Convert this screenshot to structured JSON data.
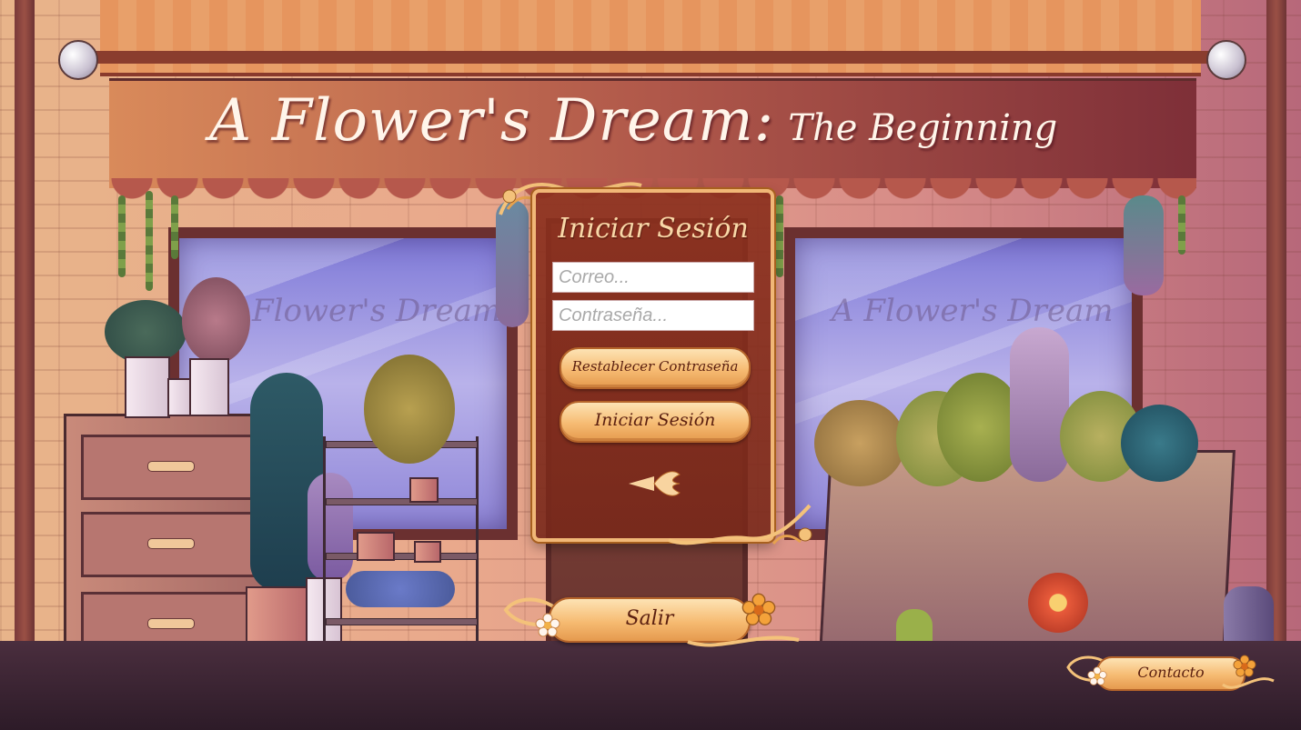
{
  "game": {
    "title_main": "A Flower's Dream:",
    "title_sub": "The Beginning"
  },
  "scene": {
    "window_left_text": "Flower's Dream",
    "window_right_text": "A Flower's Dream"
  },
  "login": {
    "heading": "Iniciar Sesión",
    "email_placeholder": "Correo...",
    "password_placeholder": "Contraseña...",
    "reset_password_label": "Restablecer Contraseña",
    "login_label": "Iniciar Sesión",
    "back_icon": "arrow-left-icon"
  },
  "footer": {
    "exit_label": "Salir",
    "contact_label": "Contacto"
  },
  "colors": {
    "panel_bg": "#8c301e",
    "panel_border": "#f1b777",
    "button_gold": "#f6bb72",
    "button_text": "#5a1f10",
    "title_text": "#fff5ea"
  }
}
